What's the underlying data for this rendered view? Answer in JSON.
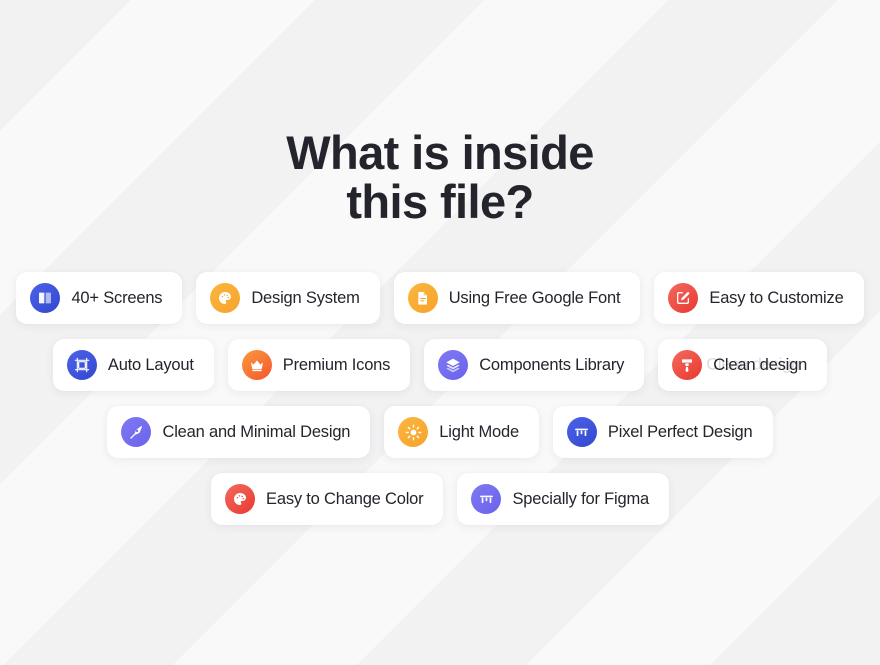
{
  "heading": {
    "line1": "What is inside",
    "line2": "this file?"
  },
  "colors": {
    "background": "#f2f2f3",
    "card_background": "#ffffff",
    "text": "#24252c",
    "blue": "#3f53dd",
    "orange": "#f9ab32",
    "red": "#ef4b3f",
    "purple": "#7670ef",
    "crown_orange": "#f7712f"
  },
  "rows": [
    {
      "cards": [
        {
          "label": "40+ Screens",
          "icon": "book-icon",
          "color": "blue"
        },
        {
          "label": "Design System",
          "icon": "palette-icon",
          "color": "orange"
        },
        {
          "label": "Using Free Google Font",
          "icon": "document-icon",
          "color": "orange"
        },
        {
          "label": "Easy to Customize",
          "icon": "edit-pencil-icon",
          "color": "red"
        }
      ]
    },
    {
      "cards": [
        {
          "label": "Auto Layout",
          "icon": "frame-icon",
          "color": "blue"
        },
        {
          "label": "Premium Icons",
          "icon": "crown-icon",
          "color": "crown"
        },
        {
          "label": "Components Library",
          "icon": "layers-icon",
          "color": "purple"
        },
        {
          "label": "Clean design",
          "icon": "paint-brush-icon",
          "color": "red",
          "ghost_text": "Clean design"
        }
      ]
    },
    {
      "cards": [
        {
          "label": "Clean and Minimal Design",
          "icon": "pen-nib-icon",
          "color": "purple"
        },
        {
          "label": "Light Mode",
          "icon": "sun-icon",
          "color": "orange"
        },
        {
          "label": "Pixel Perfect Design",
          "icon": "pixel-grid-icon",
          "color": "blue"
        }
      ]
    },
    {
      "cards": [
        {
          "label": "Easy to Change Color",
          "icon": "palette-icon",
          "color": "red"
        },
        {
          "label": "Specially for Figma",
          "icon": "pixel-grid-icon",
          "color": "purple"
        }
      ]
    }
  ]
}
